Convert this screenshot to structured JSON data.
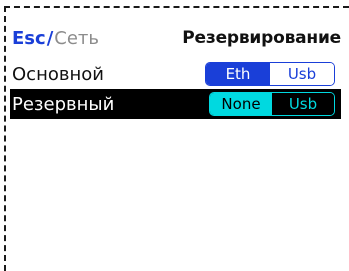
{
  "header": {
    "esc": "Esc",
    "separator": "/",
    "section": "Сеть",
    "title": "Резервирование"
  },
  "rows": [
    {
      "label": "Основной",
      "options": [
        "Eth",
        "Usb"
      ],
      "selected": "Eth",
      "focused": false
    },
    {
      "label": "Резервный",
      "options": [
        "None",
        "Usb"
      ],
      "selected": "None",
      "focused": true
    }
  ],
  "colors": {
    "accent": "#1a3fd8",
    "focus_accent": "#00d9e0",
    "focus_row_bg": "#000000",
    "muted_text": "#8c8c8c"
  }
}
